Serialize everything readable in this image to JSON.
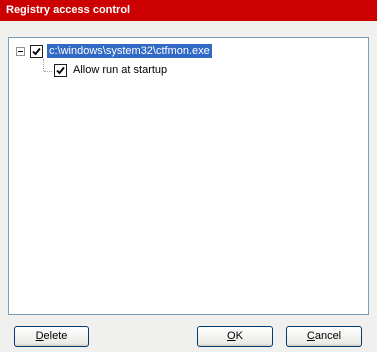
{
  "window": {
    "title": "Registry access control",
    "titlebar_color": "#cc0000"
  },
  "tree": {
    "root": {
      "label": "c:\\windows\\system32\\ctfmon.exe",
      "checked": true,
      "expanded": true,
      "selected": true,
      "expander_icon": "minus-box-icon"
    },
    "children": [
      {
        "label": "Allow run at startup",
        "checked": true
      }
    ]
  },
  "buttons": {
    "delete": {
      "mnemonic": "D",
      "rest": "elete"
    },
    "ok": {
      "mnemonic": "O",
      "rest": "K"
    },
    "cancel": {
      "mnemonic": "C",
      "rest": "ancel"
    }
  },
  "colors": {
    "selection": "#316ac5",
    "panel_border": "#7f9db9",
    "button_border": "#003c74"
  }
}
